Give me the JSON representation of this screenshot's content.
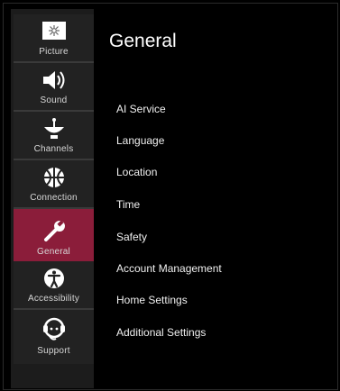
{
  "content": {
    "title": "General",
    "menu": [
      "AI Service",
      "Language",
      "Location",
      "Time",
      "Safety",
      "Account Management",
      "Home Settings",
      "Additional Settings"
    ]
  },
  "sidebar": {
    "items": [
      {
        "label": "Picture",
        "icon": "picture-icon"
      },
      {
        "label": "Sound",
        "icon": "speaker-icon"
      },
      {
        "label": "Channels",
        "icon": "satellite-dish-icon"
      },
      {
        "label": "Connection",
        "icon": "globe-icon"
      },
      {
        "label": "General",
        "icon": "wrench-icon",
        "active": true
      },
      {
        "label": "Accessibility",
        "icon": "accessibility-icon"
      },
      {
        "label": "Support",
        "icon": "support-icon"
      }
    ]
  },
  "colors": {
    "active": "#8b1d3a",
    "sidebar_bg": "#1c1c1c",
    "background": "#000000"
  }
}
